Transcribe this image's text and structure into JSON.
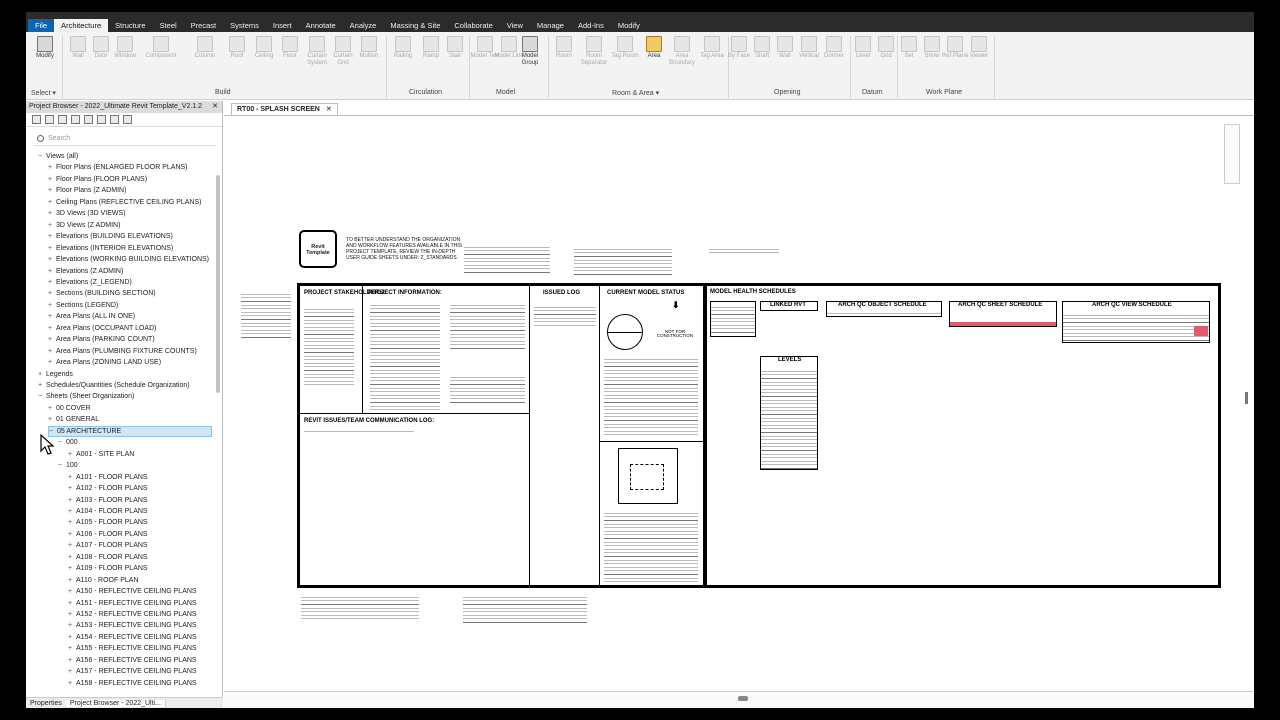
{
  "ribbon": {
    "tabs": [
      "File",
      "Architecture",
      "Structure",
      "Steel",
      "Precast",
      "Systems",
      "Insert",
      "Annotate",
      "Analyze",
      "Massing & Site",
      "Collaborate",
      "View",
      "Manage",
      "Add-Ins",
      "Modify"
    ],
    "active_tab": "Architecture",
    "buttons": {
      "modify": "Modify",
      "wall": "Wall",
      "door": "Door",
      "window": "Window",
      "component": "Component",
      "column": "Column",
      "roof": "Roof",
      "ceiling": "Ceiling",
      "floor": "Floor",
      "curtain_system": "Curtain System",
      "curtain_grid": "Curtain Grid",
      "mullion": "Mullion",
      "railing": "Railing",
      "ramp": "Ramp",
      "stair": "Stair",
      "model_text": "Model Text",
      "model_line": "Model Line",
      "model_group": "Model Group",
      "room": "Room",
      "room_separator": "Room Separator",
      "tag_room": "Tag Room",
      "area": "Area",
      "area_boundary": "Area Boundary",
      "tag_area": "Tag Area",
      "by_face": "By Face",
      "shaft": "Shaft",
      "wall_opening": "Wall",
      "vertical": "Vertical",
      "dormer": "Dormer",
      "level": "Level",
      "grid": "Grid",
      "set": "Set",
      "show": "Show",
      "ref_plane": "Ref Plane",
      "viewer": "Viewer"
    },
    "panels": {
      "select": "Select ▾",
      "build": "Build",
      "circulation": "Circulation",
      "model": "Model",
      "room_area": "Room & Area ▾",
      "opening": "Opening",
      "datum": "Datum",
      "work_plane": "Work Plane"
    }
  },
  "project_browser": {
    "title": "Project Browser - 2022_Ultimate Revit Template_V2.1.2",
    "search_placeholder": "Search",
    "tree": [
      {
        "label": "Views (all)",
        "toggle": "−",
        "level": 0
      },
      {
        "label": "Floor Plans (ENLARGED FLOOR PLANS)",
        "toggle": "+",
        "level": 1
      },
      {
        "label": "Floor Plans (FLOOR PLANS)",
        "toggle": "+",
        "level": 1
      },
      {
        "label": "Floor Plans (Z ADMIN)",
        "toggle": "+",
        "level": 1
      },
      {
        "label": "Ceiling Plans (REFLECTIVE CEILING PLANS)",
        "toggle": "+",
        "level": 1
      },
      {
        "label": "3D Views (3D VIEWS)",
        "toggle": "+",
        "level": 1
      },
      {
        "label": "3D Views (Z ADMIN)",
        "toggle": "+",
        "level": 1
      },
      {
        "label": "Elevations (BUILDING ELEVATIONS)",
        "toggle": "+",
        "level": 1
      },
      {
        "label": "Elevations (INTERIOR ELEVATIONS)",
        "toggle": "+",
        "level": 1
      },
      {
        "label": "Elevations (WORKING BUILDING ELEVATIONS)",
        "toggle": "+",
        "level": 1
      },
      {
        "label": "Elevations (Z ADMIN)",
        "toggle": "+",
        "level": 1
      },
      {
        "label": "Elevations (Z_LEGEND)",
        "toggle": "+",
        "level": 1
      },
      {
        "label": "Sections (BUILDING SECTION)",
        "toggle": "+",
        "level": 1
      },
      {
        "label": "Sections (LEGEND)",
        "toggle": "+",
        "level": 1
      },
      {
        "label": "Area Plans (ALL IN ONE)",
        "toggle": "+",
        "level": 1
      },
      {
        "label": "Area Plans (OCCUPANT LOAD)",
        "toggle": "+",
        "level": 1
      },
      {
        "label": "Area Plans (PARKING COUNT)",
        "toggle": "+",
        "level": 1
      },
      {
        "label": "Area Plans (PLUMBING FIXTURE COUNTS)",
        "toggle": "+",
        "level": 1
      },
      {
        "label": "Area Plans (ZONING LAND USE)",
        "toggle": "+",
        "level": 1
      },
      {
        "label": "Legends",
        "toggle": "+",
        "level": 0
      },
      {
        "label": "Schedules/Quantities (Schedule Organization)",
        "toggle": "+",
        "level": 0
      },
      {
        "label": "Sheets (Sheet Organization)",
        "toggle": "−",
        "level": 0
      },
      {
        "label": "00 COVER",
        "toggle": "+",
        "level": 1
      },
      {
        "label": "01 GENERAL",
        "toggle": "+",
        "level": 1
      },
      {
        "label": "05 ARCHITECTURE",
        "toggle": "−",
        "level": 1,
        "selected": true
      },
      {
        "label": "000",
        "toggle": "−",
        "level": 2
      },
      {
        "label": "A001 - SITE PLAN",
        "toggle": "+",
        "level": 3
      },
      {
        "label": "100",
        "toggle": "−",
        "level": 2
      },
      {
        "label": "A101 - FLOOR PLANS",
        "toggle": "+",
        "level": 3
      },
      {
        "label": "A102 - FLOOR PLANS",
        "toggle": "+",
        "level": 3
      },
      {
        "label": "A103 - FLOOR PLANS",
        "toggle": "+",
        "level": 3
      },
      {
        "label": "A104 - FLOOR PLANS",
        "toggle": "+",
        "level": 3
      },
      {
        "label": "A105 - FLOOR PLANS",
        "toggle": "+",
        "level": 3
      },
      {
        "label": "A106 - FLOOR PLANS",
        "toggle": "+",
        "level": 3
      },
      {
        "label": "A107 - FLOOR PLANS",
        "toggle": "+",
        "level": 3
      },
      {
        "label": "A108 - FLOOR PLANS",
        "toggle": "+",
        "level": 3
      },
      {
        "label": "A109 - FLOOR PLANS",
        "toggle": "+",
        "level": 3
      },
      {
        "label": "A110 - ROOF PLAN",
        "toggle": "+",
        "level": 3
      },
      {
        "label": "A150 - REFLECTIVE CEILING PLANS",
        "toggle": "+",
        "level": 3
      },
      {
        "label": "A151 - REFLECTIVE CEILING PLANS",
        "toggle": "+",
        "level": 3
      },
      {
        "label": "A152 - REFLECTIVE CEILING PLANS",
        "toggle": "+",
        "level": 3
      },
      {
        "label": "A153 - REFLECTIVE CEILING PLANS",
        "toggle": "+",
        "level": 3
      },
      {
        "label": "A154 - REFLECTIVE CEILING PLANS",
        "toggle": "+",
        "level": 3
      },
      {
        "label": "A155 - REFLECTIVE CEILING PLANS",
        "toggle": "+",
        "level": 3
      },
      {
        "label": "A156 - REFLECTIVE CEILING PLANS",
        "toggle": "+",
        "level": 3
      },
      {
        "label": "A157 - REFLECTIVE CEILING PLANS",
        "toggle": "+",
        "level": 3
      },
      {
        "label": "A158 - REFLECTIVE CEILING PLANS",
        "toggle": "+",
        "level": 3
      }
    ],
    "bottom_tabs": [
      "Properties",
      "Project Browser - 2022_Ulti..."
    ]
  },
  "view": {
    "tab_title": "RT00 - SPLASH SCREEN",
    "logo_text": "Revit Template",
    "intro_text": "TO BETTER UNDERSTAND THE ORGANIZATION AND WORKFLOW FEATURES AVAILABLE IN THIS PROJECT TEMPLATE, REVIEW THE IN-DEPTH USER GUIDE SHEETS UNDER: Z_STANDARDS",
    "sections": {
      "project_stakeholders": "PROJECT STAKEHOLDERS:",
      "project_information": "PROJECT INFORMATION:",
      "issued_log": "ISSUED LOG",
      "current_model_status": "CURRENT MODEL STATUS",
      "not_for_construction": "NOT FOR CONSTRUCTION",
      "revit_issues": "REVIT ISSUES/TEAM COMMUNICATION LOG:",
      "model_health": "MODEL HEALTH SCHEDULES",
      "linked_rvt": "LINKED RVT",
      "arch_qc_object": "ARCH QC OBJECT SCHEDULE",
      "arch_qc_sheet": "ARCH QC SHEET SCHEDULE",
      "arch_qc_view": "ARCH QC VIEW SCHEDULE",
      "levels": "LEVELS"
    },
    "colors": {
      "highlight_red": "#e25b6b",
      "file_tab": "#0e64b0",
      "selection": "#cfe6f7"
    }
  }
}
